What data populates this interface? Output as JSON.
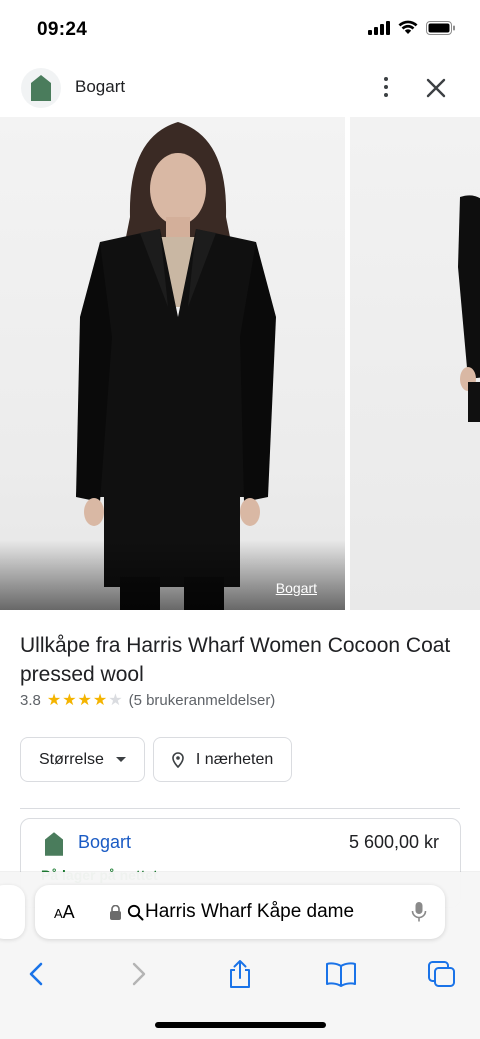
{
  "status": {
    "time": "09:24"
  },
  "header": {
    "brand": "Bogart",
    "more_icon": "more-vert-icon",
    "close_icon": "close-icon"
  },
  "images": {
    "source_label": "Bogart"
  },
  "product": {
    "title": "Ullkåpe fra Harris Wharf Women Cocoon Coat pressed wool",
    "rating": "3.8",
    "rating_value": 3.8,
    "rating_max": 5,
    "reviews": "(5 brukeranmeldelser)",
    "star_color": "#f4b400"
  },
  "filters": {
    "size": "Størrelse",
    "nearby": "I nærheten"
  },
  "offer": {
    "seller": "Bogart",
    "price": "5 600,00 kr",
    "stock": "På lager på nettet"
  },
  "browser": {
    "text_size": "AA",
    "address": "Harris Wharf Kåpe dame",
    "icons": [
      "back-icon",
      "forward-icon",
      "share-icon",
      "bookmarks-icon",
      "tabs-icon"
    ]
  },
  "colors": {
    "accent": "#1a5bc4",
    "brand_green": "#4a7c5c",
    "stock_green": "#1e7e34"
  }
}
